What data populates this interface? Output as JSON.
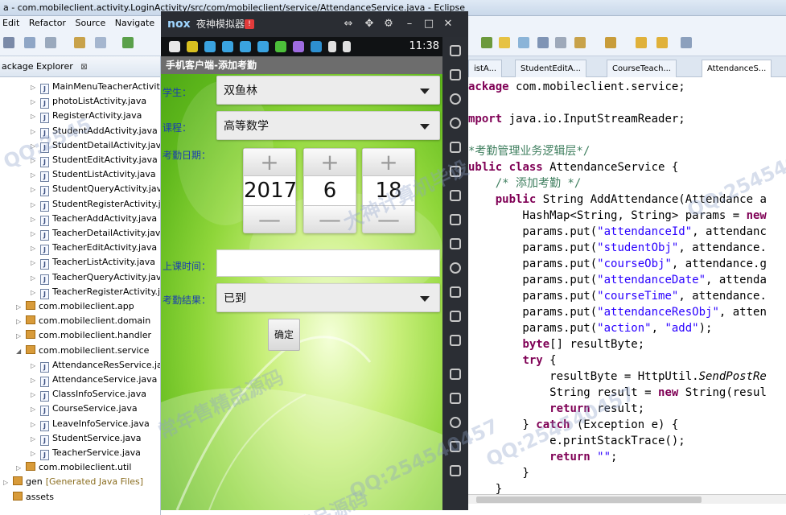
{
  "eclipse": {
    "title": "a - com.mobileclient.activity.LoginActivity/src/com/mobileclient/service/AttendanceService.java - Eclipse",
    "menu": [
      "Edit",
      "Refactor",
      "Source",
      "Navigate"
    ]
  },
  "package_explorer": {
    "title": "ackage Explorer",
    "close": "⊠",
    "items": [
      {
        "label": "MainMenuTeacherActivity",
        "kind": "java"
      },
      {
        "label": "photoListActivity.java",
        "kind": "java"
      },
      {
        "label": "RegisterActivity.java",
        "kind": "java"
      },
      {
        "label": "StudentAddActivity.java",
        "kind": "java"
      },
      {
        "label": "StudentDetailActivity.java",
        "kind": "java"
      },
      {
        "label": "StudentEditActivity.java",
        "kind": "java"
      },
      {
        "label": "StudentListActivity.java",
        "kind": "java"
      },
      {
        "label": "StudentQueryActivity.java",
        "kind": "java"
      },
      {
        "label": "StudentRegisterActivity.ja",
        "kind": "java"
      },
      {
        "label": "TeacherAddActivity.java",
        "kind": "java"
      },
      {
        "label": "TeacherDetailActivity.java",
        "kind": "java"
      },
      {
        "label": "TeacherEditActivity.java",
        "kind": "java"
      },
      {
        "label": "TeacherListActivity.java",
        "kind": "java"
      },
      {
        "label": "TeacherQueryActivity.java",
        "kind": "java"
      },
      {
        "label": "TeacherRegisterActivity.ja",
        "kind": "java"
      },
      {
        "label": "com.mobileclient.app",
        "kind": "package"
      },
      {
        "label": "com.mobileclient.domain",
        "kind": "package"
      },
      {
        "label": "com.mobileclient.handler",
        "kind": "package"
      },
      {
        "label": "com.mobileclient.service",
        "kind": "package-open"
      },
      {
        "label": "AttendanceResService.jav",
        "kind": "java"
      },
      {
        "label": "AttendanceService.java",
        "kind": "java"
      },
      {
        "label": "ClassInfoService.java",
        "kind": "java"
      },
      {
        "label": "CourseService.java",
        "kind": "java"
      },
      {
        "label": "LeaveInfoService.java",
        "kind": "java"
      },
      {
        "label": "StudentService.java",
        "kind": "java"
      },
      {
        "label": "TeacherService.java",
        "kind": "java"
      },
      {
        "label": "com.mobileclient.util",
        "kind": "package"
      },
      {
        "label": "gen",
        "kind": "gen",
        "extra": "[Generated Java Files]"
      },
      {
        "label": "assets",
        "kind": "folder"
      }
    ]
  },
  "editor": {
    "tabs": [
      "istA...",
      "StudentEditA...",
      "CourseTeach...",
      "AttendanceS..."
    ],
    "code": [
      [
        {
          "t": "ackage",
          "c": "kw"
        },
        {
          "t": " com.mobileclient.service;"
        }
      ],
      [],
      [
        {
          "t": "mport",
          "c": "kw"
        },
        {
          "t": " java.io.InputStreamReader;"
        }
      ],
      [],
      [
        {
          "t": "*考勤管理业务逻辑层*/",
          "c": "cm"
        }
      ],
      [
        {
          "t": "ublic",
          "c": "kw"
        },
        {
          "t": " "
        },
        {
          "t": "class",
          "c": "kw"
        },
        {
          "t": " AttendanceService {"
        }
      ],
      [
        {
          "t": "    /* 添加考勤 */",
          "c": "cm"
        }
      ],
      [
        {
          "t": "    "
        },
        {
          "t": "public",
          "c": "kw"
        },
        {
          "t": " String AddAttendance(Attendance a"
        }
      ],
      [
        {
          "t": "        HashMap<String, String> params = "
        },
        {
          "t": "new",
          "c": "kw"
        }
      ],
      [
        {
          "t": "        params.put("
        },
        {
          "t": "\"attendanceId\"",
          "c": "str"
        },
        {
          "t": ", attendanc"
        }
      ],
      [
        {
          "t": "        params.put("
        },
        {
          "t": "\"studentObj\"",
          "c": "str"
        },
        {
          "t": ", attendance."
        }
      ],
      [
        {
          "t": "        params.put("
        },
        {
          "t": "\"courseObj\"",
          "c": "str"
        },
        {
          "t": ", attendance.g"
        }
      ],
      [
        {
          "t": "        params.put("
        },
        {
          "t": "\"attendanceDate\"",
          "c": "str"
        },
        {
          "t": ", attenda"
        }
      ],
      [
        {
          "t": "        params.put("
        },
        {
          "t": "\"courseTime\"",
          "c": "str"
        },
        {
          "t": ", attendance."
        }
      ],
      [
        {
          "t": "        params.put("
        },
        {
          "t": "\"attendanceResObj\"",
          "c": "str"
        },
        {
          "t": ", atten"
        }
      ],
      [
        {
          "t": "        params.put("
        },
        {
          "t": "\"action\"",
          "c": "str"
        },
        {
          "t": ", "
        },
        {
          "t": "\"add\"",
          "c": "str"
        },
        {
          "t": ");"
        }
      ],
      [
        {
          "t": "        "
        },
        {
          "t": "byte",
          "c": "kw"
        },
        {
          "t": "[] resultByte;"
        }
      ],
      [
        {
          "t": "        "
        },
        {
          "t": "try",
          "c": "kw"
        },
        {
          "t": " {"
        }
      ],
      [
        {
          "t": "            resultByte = HttpUtil."
        },
        {
          "t": "SendPostRe",
          "c": "it"
        }
      ],
      [
        {
          "t": "            String result = "
        },
        {
          "t": "new",
          "c": "kw"
        },
        {
          "t": " String(resul"
        }
      ],
      [
        {
          "t": "            "
        },
        {
          "t": "return",
          "c": "kw"
        },
        {
          "t": " result;"
        }
      ],
      [
        {
          "t": "        } "
        },
        {
          "t": "catch",
          "c": "kw"
        },
        {
          "t": " (Exception e) {"
        }
      ],
      [
        {
          "t": "            e.printStackTrace();"
        }
      ],
      [
        {
          "t": "            "
        },
        {
          "t": "return",
          "c": "kw"
        },
        {
          "t": " "
        },
        {
          "t": "\"\"",
          "c": "str"
        },
        {
          "t": ";"
        }
      ],
      [
        {
          "t": "        }"
        }
      ],
      [
        {
          "t": "    }"
        }
      ]
    ]
  },
  "nox": {
    "logo": "nox",
    "title": "夜神模拟器",
    "badge": "!",
    "controls": [
      "⇔",
      "✥",
      "⚙",
      "–",
      "□",
      "✕"
    ],
    "time": "11:38",
    "app": {
      "title": "手机客户端-添加考勤",
      "student_label": "学生：",
      "student_value": "双鱼林",
      "course_label": "课程：",
      "course_value": "高等数学",
      "date_label": "考勤日期：",
      "year": "2017",
      "month": "6",
      "day": "18",
      "plus": "+",
      "minus": "—",
      "class_time_label": "上课时间：",
      "class_time_value": "",
      "result_label": "考勤结果：",
      "result_value": "已到",
      "confirm": "确定"
    }
  },
  "watermarks": [
    "QQ:2545",
    "QQ:254540457",
    "QQ:254540457",
    "QQ:254540457",
    "大神计算机毕设",
    "常年售精品源码",
    "精品源码"
  ]
}
